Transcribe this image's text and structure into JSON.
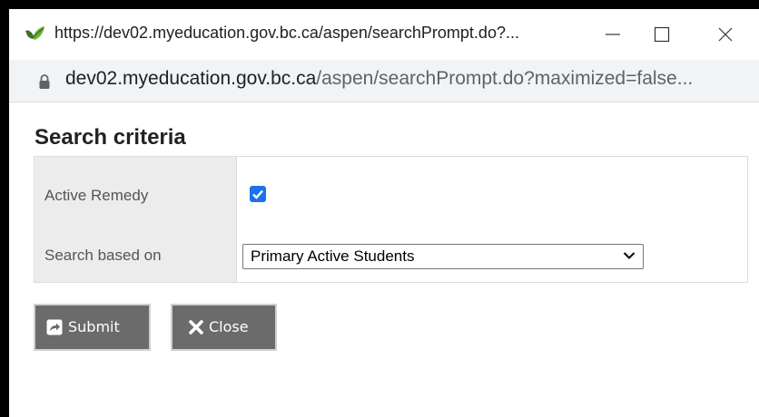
{
  "window": {
    "title": "https://dev02.myeducation.gov.bc.ca/aspen/searchPrompt.do?...",
    "controls": {
      "minimize": "minimize",
      "maximize": "maximize",
      "close": "close"
    }
  },
  "address_bar": {
    "url_host": "dev02.myeducation.gov.bc.ca",
    "url_path": "/aspen/searchPrompt.do?maximized=false..."
  },
  "page": {
    "title": "Search criteria"
  },
  "criteria": {
    "active_remedy_label": "Active Remedy",
    "active_remedy_checked": true,
    "search_based_on_label": "Search based on",
    "search_based_on_value": "Primary Active Students"
  },
  "buttons": {
    "submit": "Submit",
    "close": "Close"
  },
  "colors": {
    "checkbox": "#1a73e8",
    "button_bg": "#6b6b6b",
    "label_col_bg": "#ececec"
  },
  "icons": [
    "green-leaf-favicon-icon",
    "lock-icon",
    "chevron-down-icon",
    "share-arrow-icon",
    "x-icon"
  ]
}
